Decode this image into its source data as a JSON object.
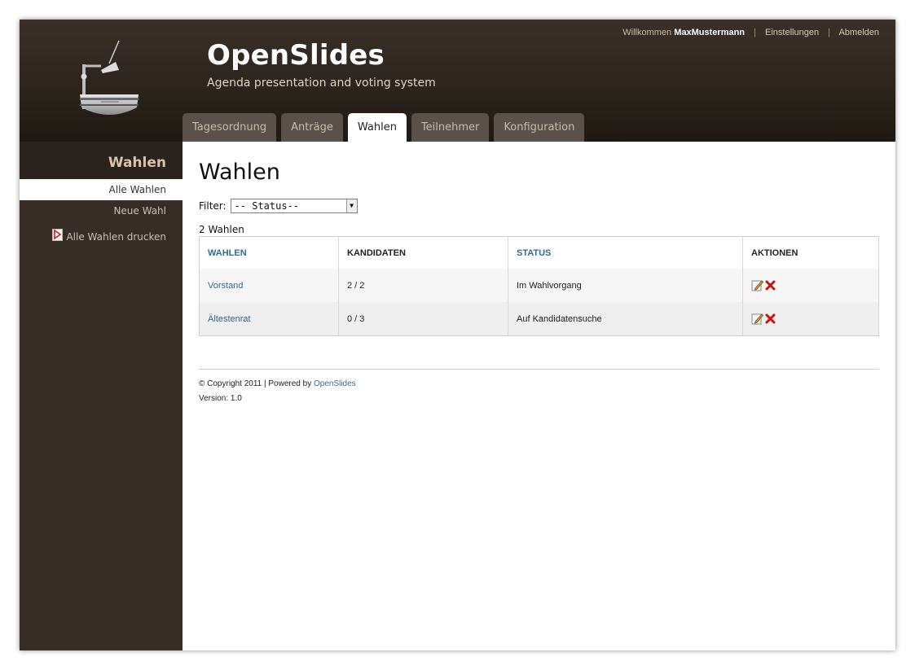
{
  "header": {
    "title": "OpenSlides",
    "subtitle": "Agenda presentation and voting system",
    "welcome_prefix": "Willkommen",
    "username": "MaxMustermann",
    "settings_link": "Einstellungen",
    "logout_link": "Abmelden",
    "separator": "|"
  },
  "tabs": [
    {
      "label": "Tagesordnung"
    },
    {
      "label": "Anträge"
    },
    {
      "label": "Wahlen"
    },
    {
      "label": "Teilnehmer"
    },
    {
      "label": "Konfiguration"
    }
  ],
  "active_tab": "Wahlen",
  "sidebar": {
    "heading": "Wahlen",
    "items": [
      {
        "label": "Alle Wahlen"
      },
      {
        "label": "Neue Wahl"
      },
      {
        "label": "Alle Wahlen drucken"
      }
    ]
  },
  "main": {
    "title": "Wahlen",
    "filter_label": "Filter:",
    "filter_value": "-- Status--",
    "count_text": "2 Wahlen",
    "table": {
      "headers": [
        "WAHLEN",
        "KANDIDATEN",
        "STATUS",
        "AKTIONEN"
      ],
      "rows": [
        {
          "name": "Vorstand",
          "candidates": "2 / 2",
          "status": "Im Wahlvorgang"
        },
        {
          "name": "Ältestenrat",
          "candidates": "0 / 3",
          "status": "Auf Kandidatensuche"
        }
      ]
    }
  },
  "footer": {
    "copyright": "© Copyright 2011 | Powered by",
    "powered_link": "OpenSlides",
    "version": "Version: 1.0"
  },
  "colors": {
    "header_bg": "#2c241d",
    "sidebar_bg": "#362d27",
    "link": "#336b93",
    "delete_icon": "#cc1111"
  }
}
